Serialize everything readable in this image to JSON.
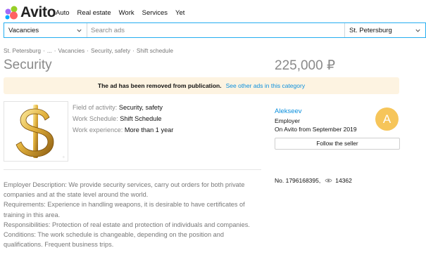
{
  "header": {
    "logo_text": "Avito",
    "nav": [
      "Auto",
      "Real estate",
      "Work",
      "Services",
      "Yet"
    ]
  },
  "search": {
    "category": "Vacancies",
    "placeholder": "Search ads",
    "city": "St. Petersburg"
  },
  "breadcrumb": [
    "St. Petersburg",
    "...",
    "Vacancies",
    "Security, safety",
    "Shift schedule"
  ],
  "ad": {
    "title": "Security",
    "price": "225,000 ₽"
  },
  "banner": {
    "message": "The ad has been removed from publication.",
    "link": "See other ads in this category"
  },
  "params": [
    {
      "label": "Field of activity:",
      "value": "Security, safety"
    },
    {
      "label": "Work Schedule:",
      "value": "Shift Schedule"
    },
    {
      "label": "Work experience:",
      "value": "More than 1 year"
    }
  ],
  "seller": {
    "name": "Alekseev",
    "role": "Employer",
    "since": "On Avito from September 2019",
    "avatar_letter": "A",
    "follow_label": "Follow the seller"
  },
  "meta": {
    "ad_number": "No. 1796168395,",
    "views": "14362"
  },
  "description": [
    "Employer Description: We provide security services, carry out orders for both private companies and at the state level around the world.",
    "Requirements: Experience in handling weapons, it is desirable to have certificates of training in this area.",
    "Responsibilities: Protection of real estate and protection of individuals and companies.",
    "Conditions: The work schedule is changeable, depending on the position and qualifications. Frequent business trips."
  ],
  "colors": {
    "accent": "#25aef0",
    "link": "#0a8fdd",
    "banner_bg": "#fdf3e1",
    "avatar_bg": "#f6c55a"
  },
  "icons": [
    "avito-logo-icon",
    "chevron-down-icon",
    "dollar-sign-image",
    "eye-icon"
  ]
}
